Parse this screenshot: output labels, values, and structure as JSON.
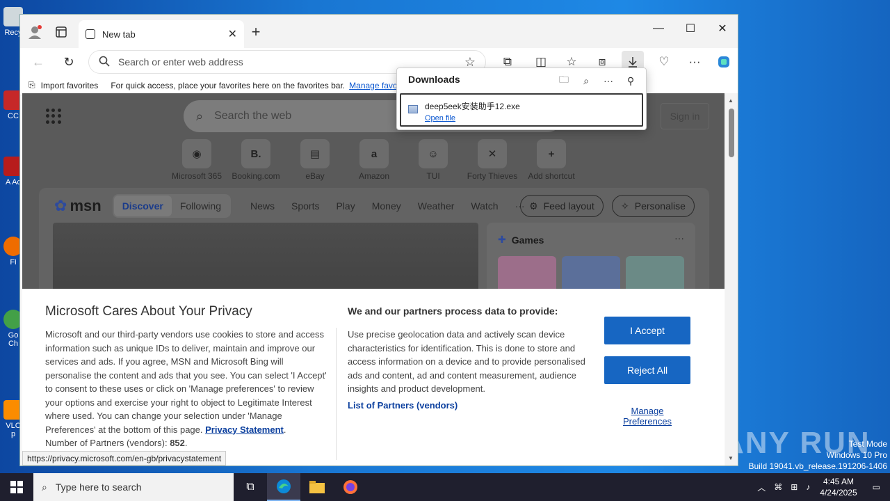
{
  "desktop": {
    "icons": [
      "Recy",
      "CC",
      "A Ac",
      "Fi",
      "Go Ch",
      "VLC p"
    ],
    "watermark": {
      "line1": "Test Mode",
      "line2": "Windows 10 Pro",
      "line3": "Build 19041.vb_release.191206-1406",
      "brand": "ANY RUN"
    }
  },
  "browser": {
    "tab": {
      "title": "New tab"
    },
    "address": {
      "placeholder": "Search or enter web address"
    },
    "favbar": {
      "import": "Import favorites",
      "hint": "For quick access, place your favorites here on the favorites bar.",
      "manage": "Manage favo"
    },
    "downloads": {
      "title": "Downloads",
      "item": {
        "filename": "deep5eek安装助手12.exe",
        "action": "Open file"
      }
    },
    "status_url": "https://privacy.microsoft.com/en-gb/privacystatement"
  },
  "newtab": {
    "search_placeholder": "Search the web",
    "signin": "Sign in",
    "shortcuts": [
      {
        "label": "Microsoft 365",
        "glyph": "◉"
      },
      {
        "label": "Booking.com",
        "glyph": "B."
      },
      {
        "label": "eBay",
        "glyph": "▤"
      },
      {
        "label": "Amazon",
        "glyph": "a"
      },
      {
        "label": "TUI",
        "glyph": "☺"
      },
      {
        "label": "Forty Thieves",
        "glyph": "✕"
      },
      {
        "label": "Add shortcut",
        "glyph": "+"
      }
    ],
    "msn": {
      "logo": "msn",
      "tabs": [
        "Discover",
        "Following"
      ],
      "links": [
        "News",
        "Sports",
        "Play",
        "Money",
        "Weather",
        "Watch",
        "···"
      ],
      "feed_layout": "Feed layout",
      "personalise": "Personalise",
      "games_title": "Games",
      "games_more": "···"
    }
  },
  "privacy": {
    "title": "Microsoft Cares About Your Privacy",
    "body_part1": "Microsoft and our third-party vendors use cookies to store and access information such as unique IDs to deliver, maintain and improve our services and ads. If you agree, MSN and Microsoft Bing will personalise the content and ads that you see. You can select 'I Accept' to consent to these uses or click on 'Manage preferences' to review your options and exercise your right to object to Legitimate Interest where used.  You can change your selection under 'Manage Preferences' at the bottom of this page.",
    "privacy_link": "Privacy Statement",
    "partners_count_label": "Number of Partners (vendors):",
    "partners_count": "852",
    "process_title": "We and our partners process data to provide:",
    "process_body": "Use precise geolocation data and actively scan device characteristics for identification. This is done to store and access information on a device and to provide personalised ads and content, ad and content measurement, audience insights and product development.",
    "partners_link": "List of Partners (vendors)",
    "accept": "I Accept",
    "reject": "Reject All",
    "manage_line1": "Manage",
    "manage_line2": "Preferences"
  },
  "taskbar": {
    "search_placeholder": "Type here to search",
    "time": "4:45 AM",
    "date": "4/24/2025"
  }
}
